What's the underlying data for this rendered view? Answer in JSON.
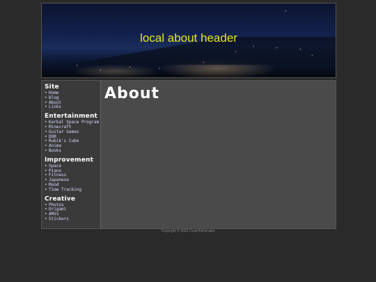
{
  "header": {
    "title": "local about header"
  },
  "sidebar": {
    "sections": [
      {
        "title": "Site",
        "items": [
          "Home",
          "Blog",
          "About",
          "Links"
        ]
      },
      {
        "title": "Entertainment",
        "items": [
          "Kerbal Space Program",
          "Minecraft",
          "Guitar Games",
          "DDR",
          "Rubik's Cube",
          "Anime",
          "Books"
        ]
      },
      {
        "title": "Improvement",
        "items": [
          "Space",
          "Piano",
          "Fitness",
          "Japanese",
          "Mood",
          "Time Tracking"
        ]
      },
      {
        "title": "Creative",
        "items": [
          "Photos",
          "Origami",
          "AMVs",
          "Stickers"
        ]
      }
    ]
  },
  "main": {
    "title": "About"
  },
  "footer": {
    "text": "Copyright © 2023 CoastToKoryako"
  }
}
